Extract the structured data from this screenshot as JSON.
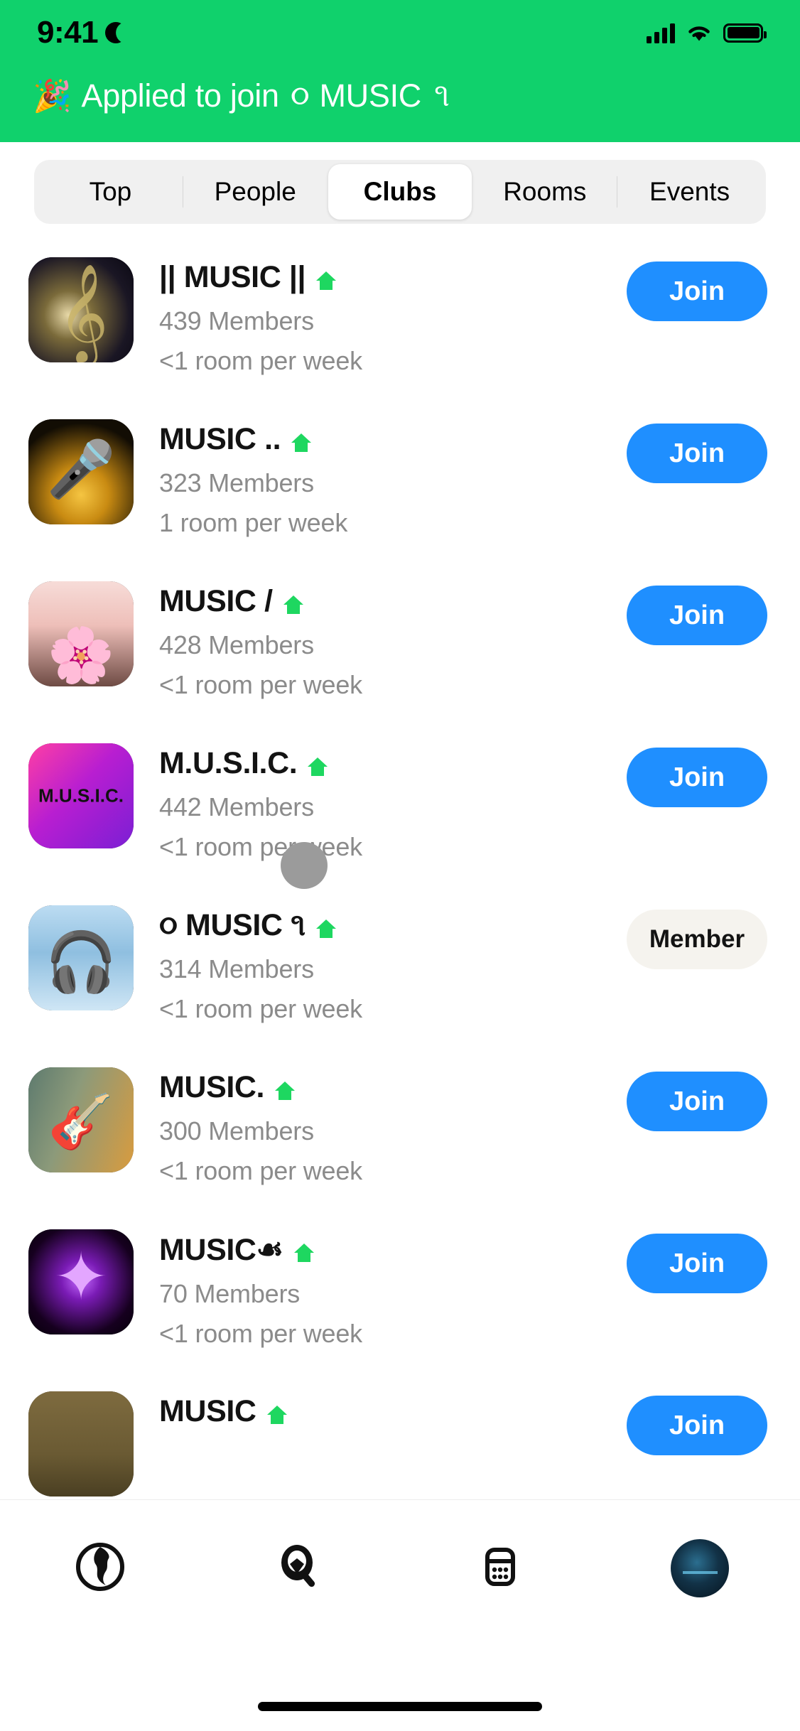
{
  "status_bar": {
    "time": "9:41",
    "moon_icon": "crescent-moon-icon",
    "signal_icon": "cellular-signal-icon",
    "wifi_icon": "wifi-icon",
    "battery_icon": "battery-full-icon"
  },
  "toast": {
    "emoji": "🎉",
    "message": "Applied to join",
    "club_ornament_left": "૦",
    "club_name": "MUSIC",
    "club_ornament_right": "૧",
    "background_color": "#10d16c",
    "text_color": "#ffffff"
  },
  "tabs": {
    "items": [
      {
        "label": "Top",
        "selected": false
      },
      {
        "label": "People",
        "selected": false
      },
      {
        "label": "Clubs",
        "selected": true
      },
      {
        "label": "Rooms",
        "selected": false
      },
      {
        "label": "Events",
        "selected": false
      }
    ]
  },
  "colors": {
    "join_blue": "#1f8fff",
    "member_pill": "#f5f3ee",
    "house_green": "#1ed760",
    "meta_gray": "#8b8b8b"
  },
  "clubs": [
    {
      "name": "|| MUSIC ||",
      "house_icon": "house-icon",
      "members": "439 Members",
      "rooms": "<1 room per week",
      "action": "Join",
      "action_state": "join",
      "avatar_icon": "club-avatar-treble-clef"
    },
    {
      "name": "MUSIC ..",
      "house_icon": "house-icon",
      "members": "323 Members",
      "rooms": "1 room per week",
      "action": "Join",
      "action_state": "join",
      "avatar_icon": "club-avatar-gold-microphone"
    },
    {
      "name": "MUSIC /",
      "house_icon": "house-icon",
      "members": "428 Members",
      "rooms": "<1 room per week",
      "action": "Join",
      "action_state": "join",
      "avatar_icon": "club-avatar-pink-roses"
    },
    {
      "name": "M.U.S.I.C.",
      "house_icon": "house-icon",
      "members": "442 Members",
      "rooms": "<1 room per week",
      "action": "Join",
      "action_state": "join",
      "avatar_icon": "club-avatar-magenta-logo"
    },
    {
      "name": "૦ MUSIC ૧",
      "house_icon": "house-icon",
      "members": "314 Members",
      "rooms": "<1 room per week",
      "action": "Member",
      "action_state": "member",
      "avatar_icon": "club-avatar-headphones-sky"
    },
    {
      "name": "MUSIC.",
      "house_icon": "house-icon",
      "members": "300 Members",
      "rooms": "<1 room per week",
      "action": "Join",
      "action_state": "join",
      "avatar_icon": "club-avatar-guitar-painting"
    },
    {
      "name": "MUSIC☙",
      "house_icon": "house-icon",
      "members": "70 Members",
      "rooms": "<1 room per week",
      "action": "Join",
      "action_state": "join",
      "avatar_icon": "club-avatar-purple-creature"
    },
    {
      "name": "MUSIC",
      "house_icon": "house-icon",
      "members": "",
      "rooms": "",
      "action": "Join",
      "action_state": "join",
      "avatar_icon": "club-avatar-brown-clipped"
    }
  ],
  "bottom_nav": {
    "items": [
      {
        "icon": "globe-icon",
        "label": ""
      },
      {
        "icon": "search-icon",
        "label": ""
      },
      {
        "icon": "calendar-icon",
        "label": ""
      },
      {
        "icon": "profile-avatar-icon",
        "label": ""
      }
    ]
  },
  "touch_indicator": {
    "visible": true
  }
}
